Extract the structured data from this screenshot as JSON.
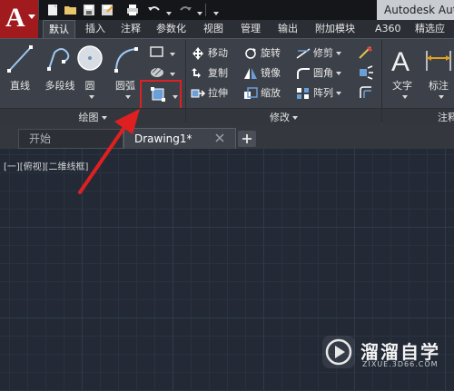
{
  "app": {
    "title": "Autodesk Aut",
    "logo_letter": "A"
  },
  "quick_access": [
    "new-icon",
    "open-icon",
    "save-icon",
    "saveas-icon",
    "print-icon",
    "undo-icon",
    "redo-icon",
    "customize-icon"
  ],
  "ribbon_tabs": [
    "默认",
    "插入",
    "注释",
    "参数化",
    "视图",
    "管理",
    "输出",
    "附加模块",
    "A360",
    "精选应"
  ],
  "active_tab": "默认",
  "draw_panel": {
    "title": "绘图",
    "tools": [
      {
        "label": "直线",
        "icon": "line-icon"
      },
      {
        "label": "多段线",
        "icon": "polyline-icon"
      },
      {
        "label": "圆",
        "icon": "circle-icon"
      },
      {
        "label": "圆弧",
        "icon": "arc-icon"
      }
    ],
    "small_tools": [
      "rectangle-icon",
      "hatch-icon",
      "boundary-icon"
    ]
  },
  "modify_panel": {
    "title": "修改",
    "rows": [
      [
        "移动",
        "旋转",
        "修剪"
      ],
      [
        "复制",
        "镜像",
        "圆角"
      ],
      [
        "拉伸",
        "缩放",
        "阵列"
      ]
    ]
  },
  "annotation_panel": {
    "title": "注释",
    "tools": [
      {
        "label": "文字",
        "icon": "text-icon"
      },
      {
        "label": "标注",
        "icon": "dimension-icon"
      }
    ]
  },
  "doc_tabs": [
    {
      "label": "开始",
      "active": false
    },
    {
      "label": "Drawing1*",
      "active": true
    }
  ],
  "viewport_label": "[一][俯视][二维线框]",
  "watermark": {
    "title": "溜溜自学",
    "url": "ZIXUE.3D66.COM"
  },
  "colors": {
    "accent_red": "#e02020",
    "app_red": "#a11a1d",
    "canvas": "#232a36"
  }
}
